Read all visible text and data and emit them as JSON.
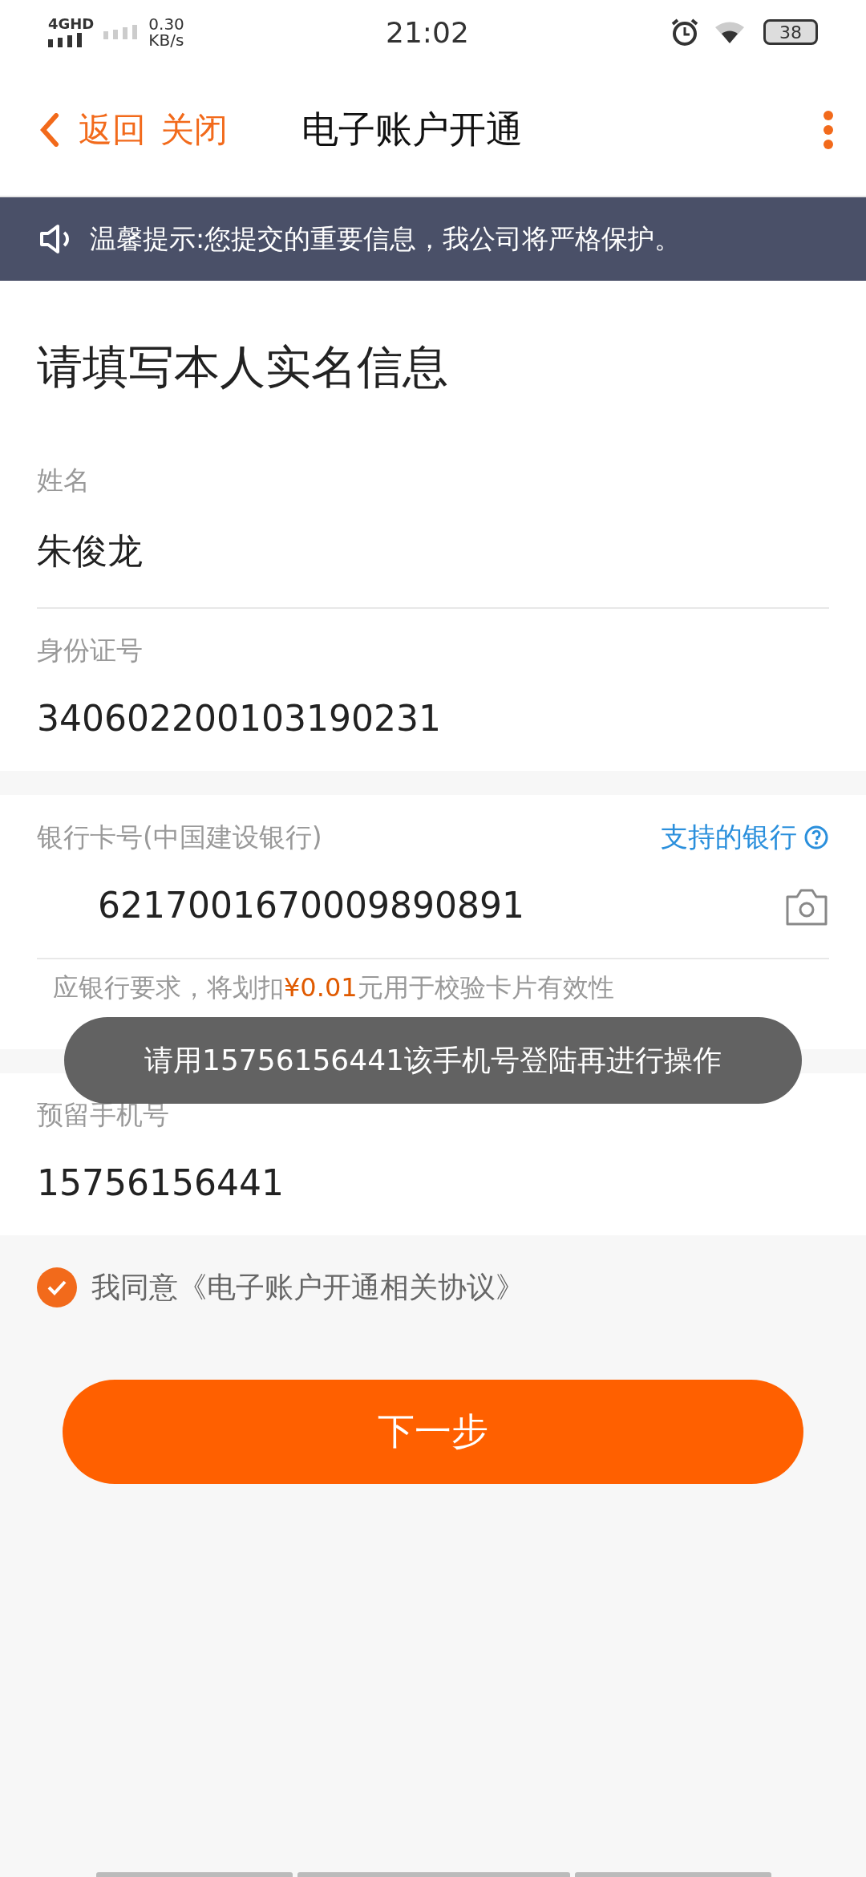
{
  "status_bar": {
    "network": "4GHD",
    "speed": "0.30",
    "speed_unit": "KB/s",
    "time": "21:02",
    "battery": "38"
  },
  "header": {
    "back": "返回",
    "close": "关闭",
    "title": "电子账户开通"
  },
  "notice": "温馨提示:您提交的重要信息，我公司将严格保护。",
  "form_title": "请填写本人实名信息",
  "fields": [
    {
      "label": "姓名",
      "value": "朱俊龙"
    },
    {
      "label": "身份证号",
      "value": "340602200103190231"
    }
  ],
  "bank": {
    "label": "银行卡号(中国建设银行)",
    "link": "支持的银行",
    "value": "6217001670009890891",
    "hint_before": "应银行要求，将划扣",
    "hint_amount": "¥0.01",
    "hint_after": "元用于校验卡片有效性"
  },
  "phone": {
    "label": "预留手机号",
    "value": "15756156441"
  },
  "agreement": {
    "checked": true,
    "text": "我同意《电子账户开通相关协议》"
  },
  "next_button": "下一步",
  "toast": "请用15756156441该手机号登陆再进行操作"
}
